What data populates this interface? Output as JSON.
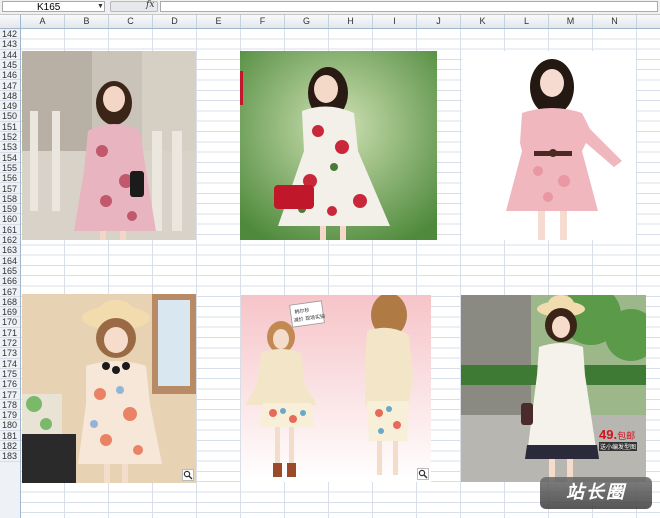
{
  "name_box": {
    "value": "K165"
  },
  "formula_bar": {
    "fx_label": "fx",
    "value": ""
  },
  "columns": [
    "A",
    "B",
    "C",
    "D",
    "E",
    "F",
    "G",
    "H",
    "I",
    "J",
    "K",
    "L",
    "M",
    "N"
  ],
  "rows": [
    "142",
    "143",
    "144",
    "145",
    "146",
    "147",
    "148",
    "149",
    "150",
    "151",
    "152",
    "153",
    "154",
    "155",
    "156",
    "157",
    "158",
    "159",
    "160",
    "161",
    "162",
    "163",
    "164",
    "165",
    "166",
    "167",
    "168",
    "169",
    "170",
    "171",
    "172",
    "173",
    "174",
    "175",
    "176",
    "177",
    "178",
    "179",
    "180",
    "181",
    "182",
    "183"
  ],
  "photos": [
    {
      "id": "photo-1",
      "description_icon": "dress-photo",
      "dress_color": "#e8b4c0"
    },
    {
      "id": "photo-2",
      "description_icon": "dress-photo",
      "dress_color": "#f2f0e8"
    },
    {
      "id": "photo-3",
      "description_icon": "dress-photo",
      "dress_color": "#f1b7bf"
    },
    {
      "id": "photo-4",
      "description_icon": "dress-photo",
      "dress_color": "#f6e7d8"
    },
    {
      "id": "photo-5",
      "description_icon": "dress-photo",
      "dress_color": "#f3e6c8"
    },
    {
      "id": "photo-6",
      "description_icon": "dress-photo",
      "dress_color": "#f4f2ea"
    }
  ],
  "price_tag": {
    "value": "49.",
    "suffix": "包邮",
    "subtext": "送小编发型图"
  },
  "sticker_text": "韩尔秒\n减价 现场实拍",
  "watermark": "站长圈",
  "icons": {
    "zoom": "magnifier-icon",
    "fx": "function-icon",
    "dropdown": "chevron-down-icon"
  }
}
